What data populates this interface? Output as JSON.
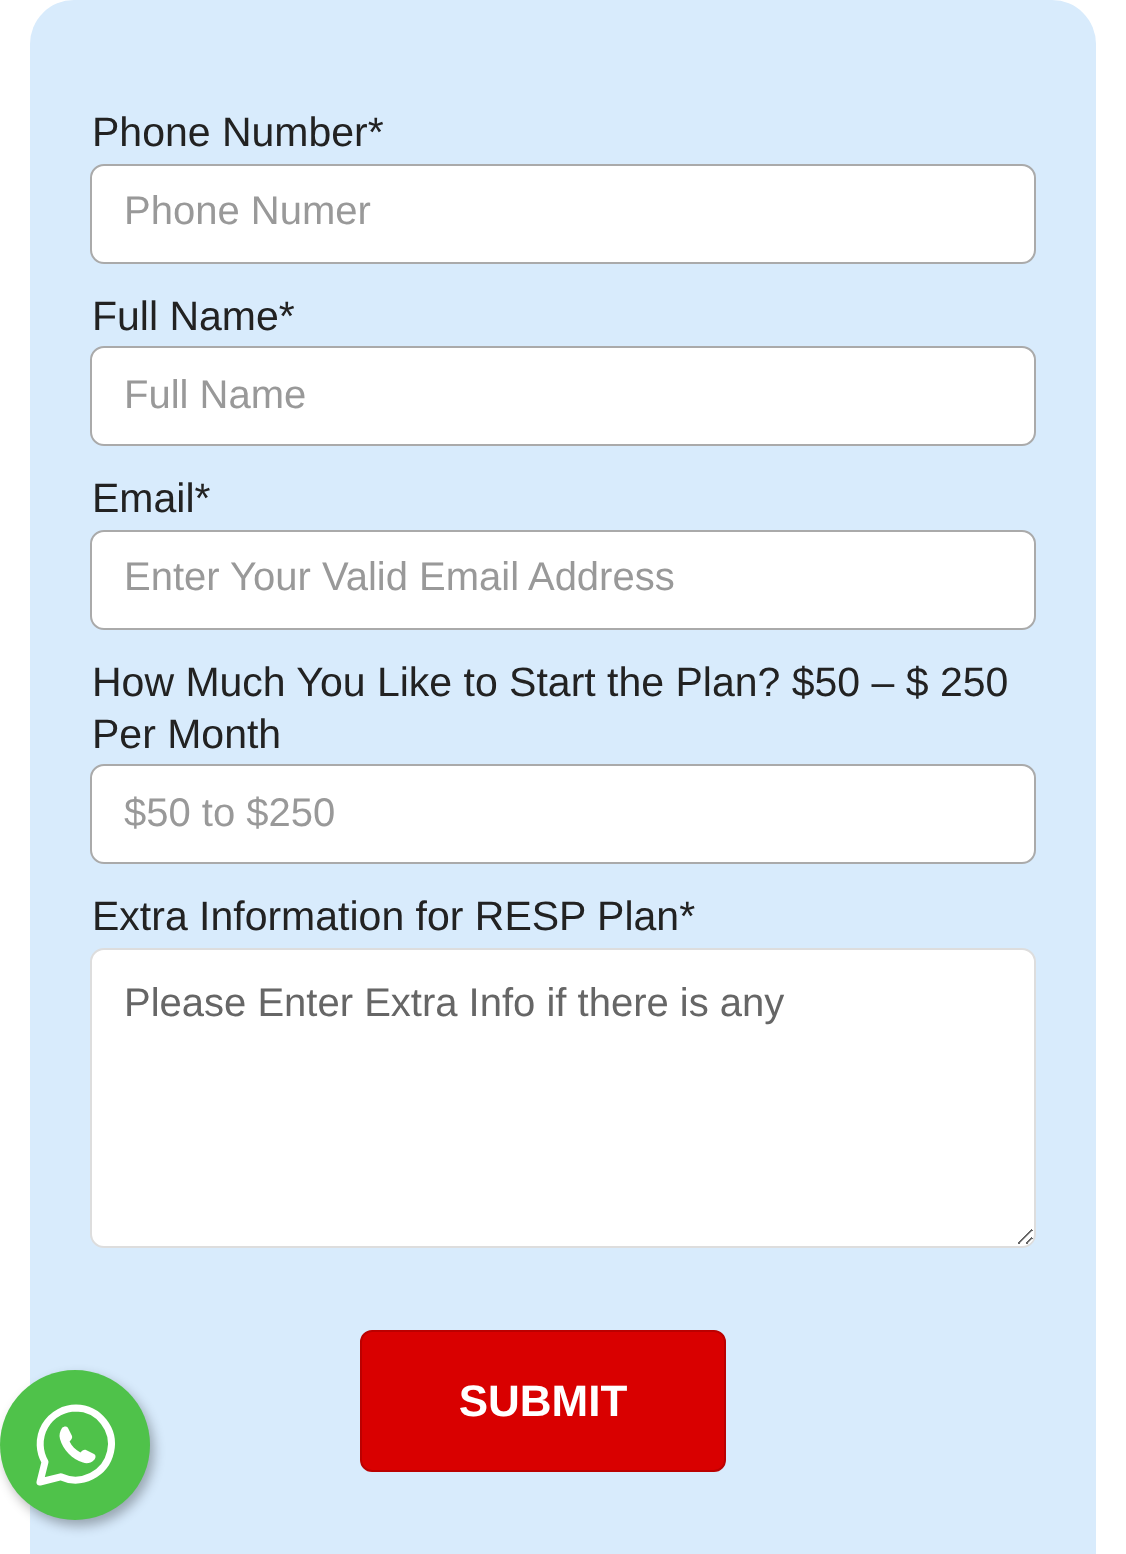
{
  "form": {
    "fields": [
      {
        "kind": "input",
        "label": "Phone Number*",
        "placeholder": "Phone Numer"
      },
      {
        "kind": "input",
        "label": "Full Name*",
        "placeholder": "Full Name"
      },
      {
        "kind": "input",
        "label": "Email*",
        "placeholder": "Enter Your Valid Email Address"
      },
      {
        "kind": "input",
        "label": "How Much You Like to Start the Plan? $50 – $ 250 Per Month",
        "placeholder": "$50 to $250"
      },
      {
        "kind": "textarea",
        "label": "Extra Information for RESP Plan*",
        "placeholder": "Please Enter Extra Info if there is any"
      }
    ],
    "submit_button": "SUBMIT"
  }
}
